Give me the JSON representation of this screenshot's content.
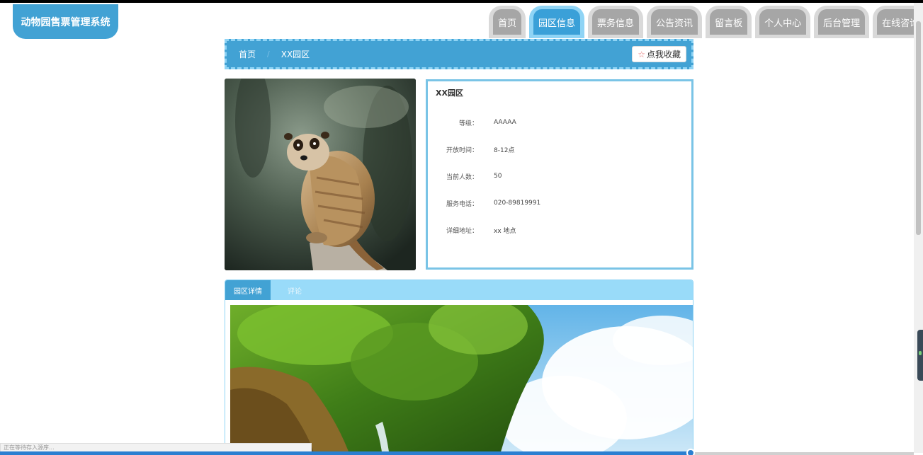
{
  "site": {
    "title": "动物园售票管理系统"
  },
  "nav": {
    "items": [
      {
        "label": "首页",
        "active": false
      },
      {
        "label": "园区信息",
        "active": true
      },
      {
        "label": "票务信息",
        "active": false
      },
      {
        "label": "公告资讯",
        "active": false
      },
      {
        "label": "留言板",
        "active": false
      },
      {
        "label": "个人中心",
        "active": false
      },
      {
        "label": "后台管理",
        "active": false
      },
      {
        "label": "在线咨询",
        "active": false
      }
    ]
  },
  "breadcrumb": {
    "home": "首页",
    "separator": "/",
    "current": "XX园区",
    "favorite_label": "点我收藏"
  },
  "info": {
    "title": "XX园区",
    "rows": [
      {
        "label": "等级：",
        "value": "AAAAA"
      },
      {
        "label": "开放时间：",
        "value": "8-12点"
      },
      {
        "label": "当前人数：",
        "value": "50"
      },
      {
        "label": "服务电话：",
        "value": "020-89819991"
      },
      {
        "label": "详细地址：",
        "value": "xx 地点"
      }
    ]
  },
  "detail_tabs": {
    "tab1": "园区详情",
    "tab2": "评论"
  },
  "status_bar": {
    "text": "正在等待存入源序..."
  },
  "colors": {
    "primary": "#42a2d4",
    "light": "#8fd4f5",
    "nav_inactive": "#a6a6a6"
  }
}
